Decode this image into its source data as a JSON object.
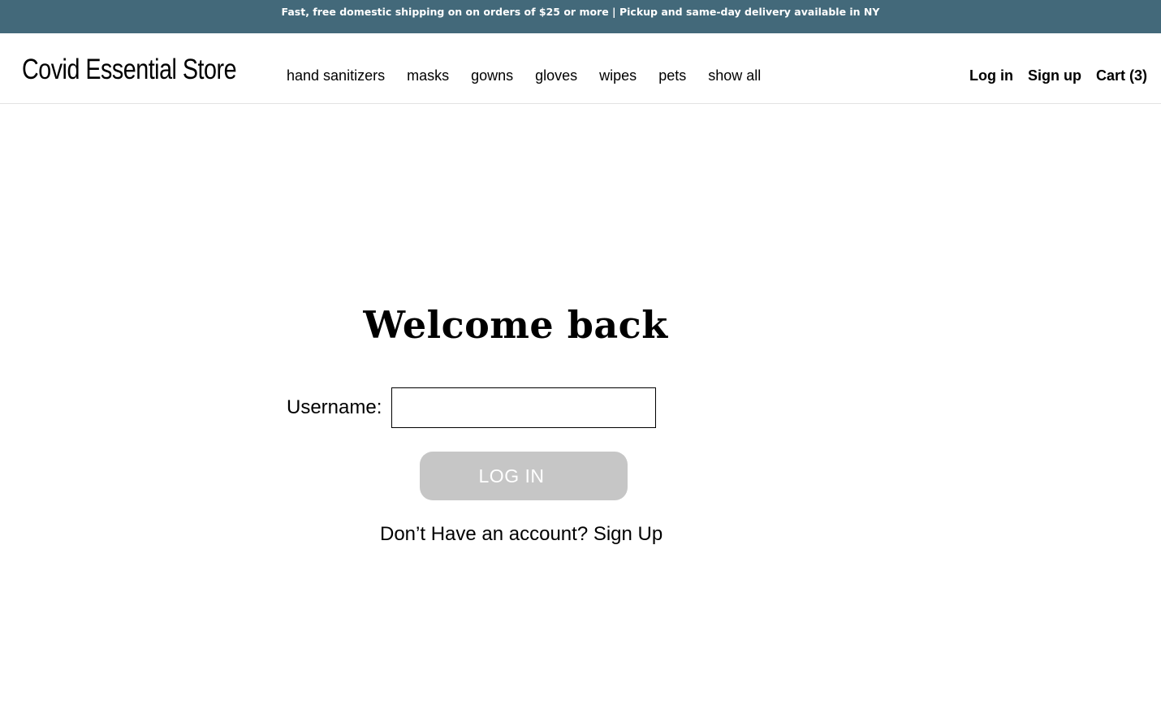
{
  "announcement": {
    "text": "Fast, free domestic shipping on on orders of $25 or more | Pickup and same-day delivery available in NY",
    "background_color": "#43697a"
  },
  "header": {
    "logo": "Covid Essential Store",
    "nav": [
      {
        "label": "hand sanitizers"
      },
      {
        "label": "masks"
      },
      {
        "label": "gowns"
      },
      {
        "label": "gloves"
      },
      {
        "label": "wipes"
      },
      {
        "label": "pets"
      },
      {
        "label": "show all"
      }
    ],
    "account": {
      "login_label": "Log in",
      "signup_label": "Sign up",
      "cart_label": "Cart (3)"
    }
  },
  "login_form": {
    "title": "Welcome back",
    "username_label": "Username:",
    "username_value": "",
    "submit_label": "LOG IN",
    "submit_disabled_color": "#c6c6c6",
    "signup_prompt": "Don’t Have an account?",
    "signup_link": "Sign Up"
  }
}
